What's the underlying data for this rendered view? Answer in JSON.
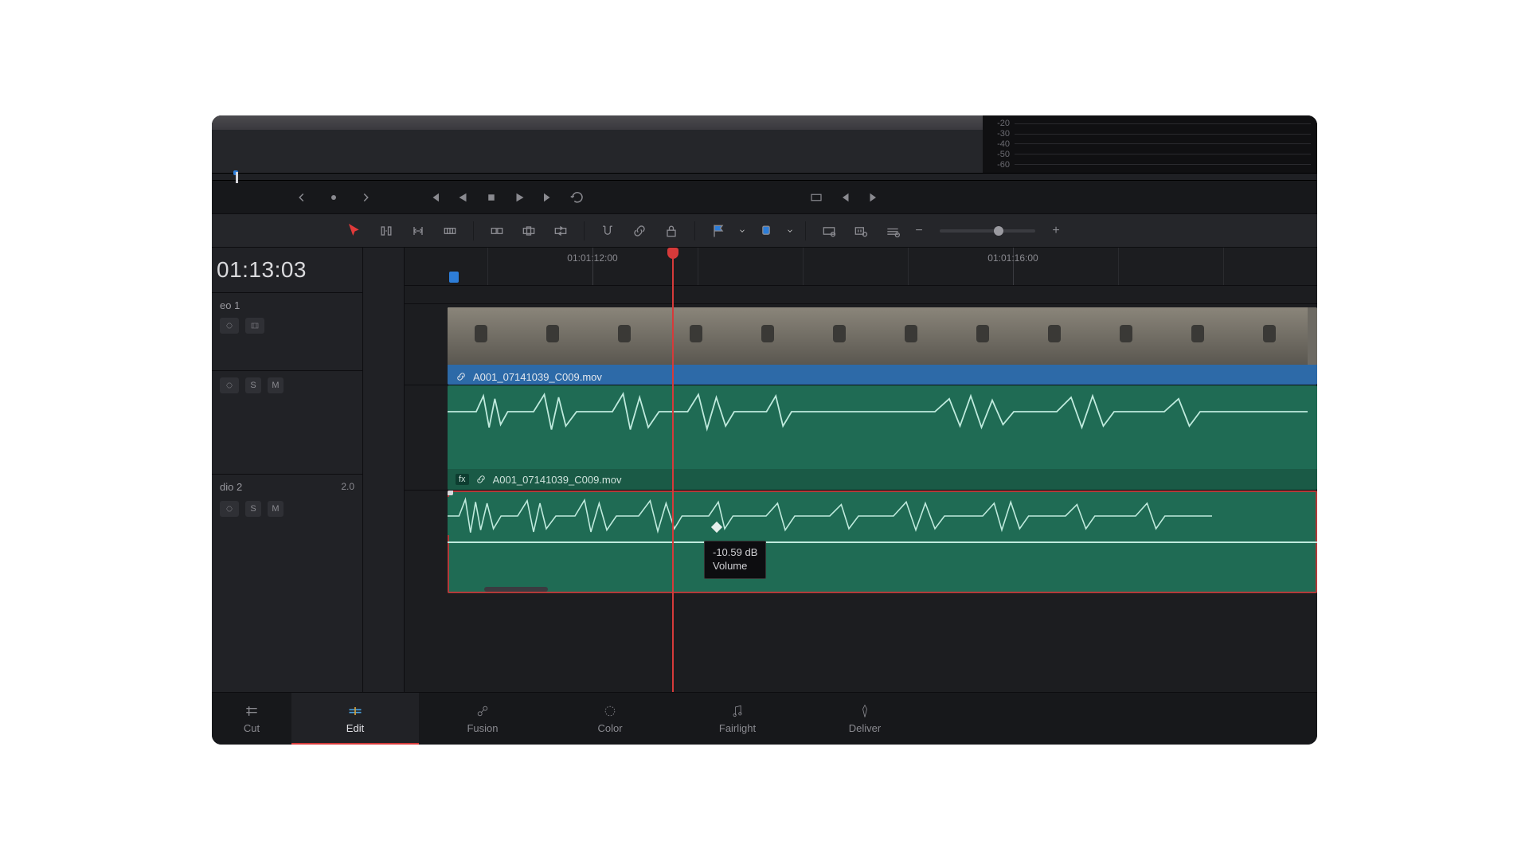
{
  "meter_labels": [
    "-20",
    "-30",
    "-40",
    "-50",
    "-60"
  ],
  "timecode": "01:13:03",
  "ruler": {
    "t1": "01:01:12:00",
    "t2": "01:01:16:00"
  },
  "tracks": {
    "video1": {
      "name": "eo 1"
    },
    "audio1": {
      "name": ""
    },
    "audio2": {
      "name": "dio 2",
      "value": "2.0"
    }
  },
  "track_buttons": {
    "solo": "S",
    "mute": "M"
  },
  "clips": {
    "video1": {
      "filename": "A001_07141039_C009.mov"
    },
    "audio1": {
      "filename": "A001_07141039_C009.mov"
    }
  },
  "tooltip": {
    "value": "-10.59 dB",
    "label": "Volume"
  },
  "pages": {
    "cut": "Cut",
    "edit": "Edit",
    "fusion": "Fusion",
    "color": "Color",
    "fairlight": "Fairlight",
    "deliver": "Deliver"
  },
  "colors": {
    "accent_red": "#d63a3a",
    "accent_blue": "#2d7dd8",
    "audio_green": "#1f6b54",
    "video_blue": "#2d6aa8"
  }
}
